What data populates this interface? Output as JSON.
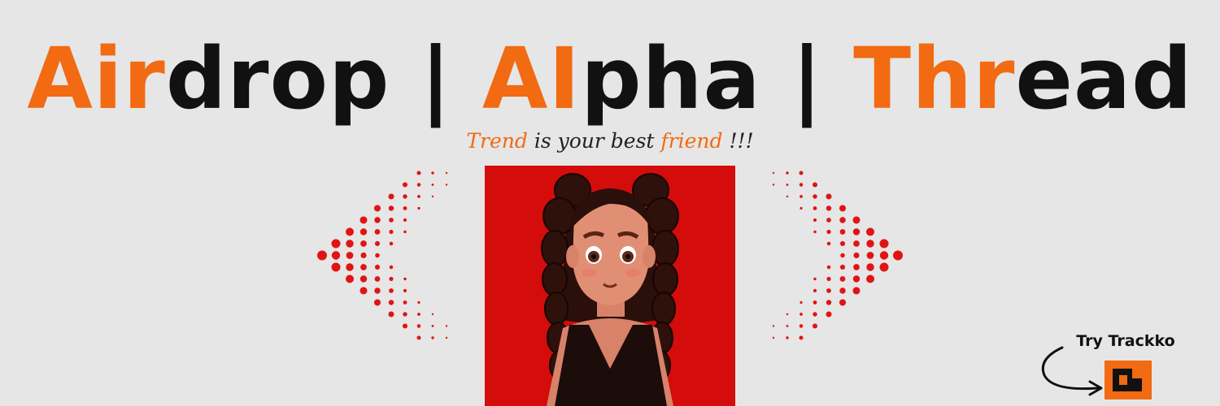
{
  "title": {
    "part1_hl": "Air",
    "part1_rest": "drop",
    "sep1": " | ",
    "part2_hl": "AI",
    "part2_rest": "pha",
    "sep2": " | ",
    "part3_hl": "Thr",
    "part3_rest": "ead"
  },
  "tagline": {
    "word1": "Trend",
    "mid": " is your best ",
    "word2": "friend",
    "end": " !!!"
  },
  "cta": {
    "label": "Try Trackko"
  },
  "colors": {
    "accent": "#f26a12",
    "text": "#111111",
    "background": "#e6e6e6",
    "portrait_bg": "#d40c0c",
    "dots": "#e11414"
  },
  "icons": {
    "left_decoration": "left-chevron-dots-icon",
    "right_decoration": "right-chevron-dots-icon",
    "arrow": "curved-arrow-icon",
    "logo": "trackko-logo-icon"
  }
}
